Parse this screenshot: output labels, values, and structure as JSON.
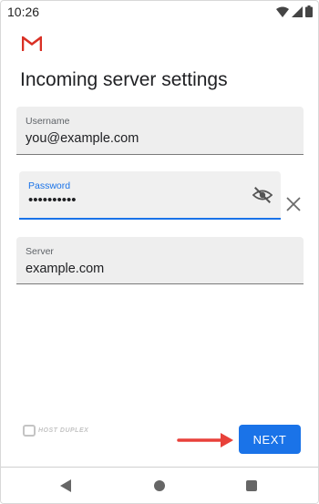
{
  "status_bar": {
    "time": "10:26",
    "icons": [
      "wifi-icon",
      "signal-icon",
      "battery-icon"
    ]
  },
  "app": {
    "logo_icon": "gmail-logo",
    "title": "Incoming server settings"
  },
  "form": {
    "username": {
      "label": "Username",
      "value": "you@example.com"
    },
    "password": {
      "label": "Password",
      "value": "••••••••••",
      "toggle_icon": "visibility-off-icon",
      "clear_icon": "close-icon"
    },
    "server": {
      "label": "Server",
      "value": "example.com"
    }
  },
  "watermark": {
    "text": "HOST DUPLEX"
  },
  "actions": {
    "next_label": "NEXT",
    "annotation_icon": "red-arrow-icon"
  },
  "nav_bar": {
    "icons": [
      "back-icon",
      "home-icon",
      "recents-icon"
    ]
  },
  "colors": {
    "accent": "#1a73e8",
    "arrow": "#e8413a",
    "gmail_red": "#d93025"
  }
}
